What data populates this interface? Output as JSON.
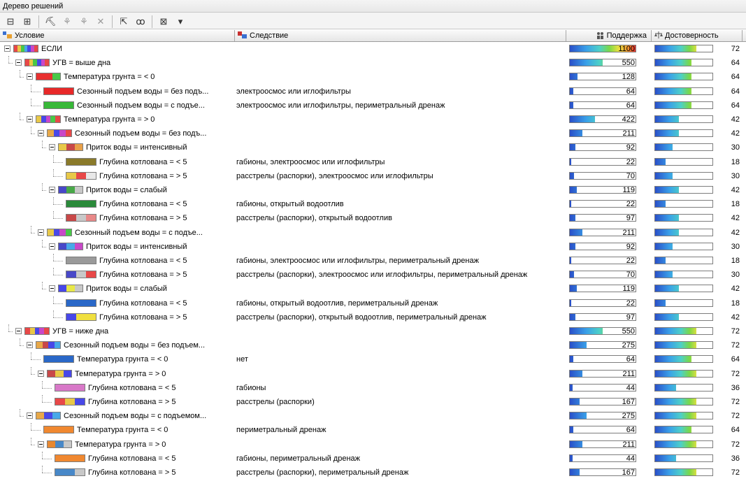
{
  "window": {
    "title": "Дерево решений"
  },
  "toolbar": {
    "buttons": [
      {
        "name": "collapse-all-icon",
        "glyph": "⊟"
      },
      {
        "name": "expand-all-icon",
        "glyph": "⊞"
      },
      {
        "name": "sep"
      },
      {
        "name": "tree-chart-icon",
        "glyph": "⛏"
      },
      {
        "name": "prune-icon",
        "glyph": "⚘",
        "dim": true
      },
      {
        "name": "split-icon",
        "glyph": "⚘",
        "dim": true
      },
      {
        "name": "delete-icon",
        "glyph": "✕",
        "dim": true
      },
      {
        "name": "sep"
      },
      {
        "name": "select-node-icon",
        "glyph": "⇱"
      },
      {
        "name": "view-icon",
        "glyph": "ꝏ"
      },
      {
        "name": "sep"
      },
      {
        "name": "excel-export-icon",
        "glyph": "⊠"
      },
      {
        "name": "dropdown-arrow-icon",
        "glyph": "▾"
      }
    ]
  },
  "columns": {
    "condition": "Условие",
    "consequence": "Следствие",
    "support": "Поддержка",
    "confidence": "Достоверность"
  },
  "colors": {
    "bar_blue": "#3a6fd0",
    "bar_cyan": "#4dc9e8",
    "bar_green": "#5bc85b",
    "bar_yellow": "#f0e040",
    "bar_orange": "#f09a30",
    "bar_red": "#e83030"
  },
  "rows": [
    {
      "level": 0,
      "label": "ЕСЛИ",
      "consequence": "",
      "support": 1100,
      "confidence": 72,
      "expander": true,
      "swatch": [
        "#e84848",
        "#e8c848",
        "#48c848",
        "#48a8e8",
        "#4848e8",
        "#c848c8",
        "#e84848"
      ]
    },
    {
      "level": 1,
      "label": "УГВ = выше дна",
      "consequence": "",
      "support": 550,
      "confidence": 64,
      "expander": true,
      "swatch": [
        "#e84848",
        "#e8c848",
        "#48c848",
        "#4848e8",
        "#c848c8",
        "#e84848"
      ]
    },
    {
      "level": 2,
      "label": "Температура грунта = < 0",
      "consequence": "",
      "support": 128,
      "confidence": 64,
      "expander": true,
      "swatch": [
        "#e83030",
        "#e83030",
        "#48c848"
      ]
    },
    {
      "level": 3,
      "label": "Сезонный подъем воды = без подъ...",
      "consequence": "электроосмос или иглофильтры",
      "support": 64,
      "confidence": 64,
      "expander": false,
      "swatch": [
        "#e82828"
      ]
    },
    {
      "level": 3,
      "label": "Сезонный подъем воды = с подъе...",
      "consequence": "электроосмос или иглофильтры, периметральный дренаж",
      "support": 64,
      "confidence": 64,
      "expander": false,
      "swatch": [
        "#38b838"
      ]
    },
    {
      "level": 2,
      "label": "Температура грунта = > 0",
      "consequence": "",
      "support": 422,
      "confidence": 42,
      "expander": true,
      "swatch": [
        "#e8c848",
        "#4848e8",
        "#c848c8",
        "#48c848",
        "#e84848"
      ]
    },
    {
      "level": 3,
      "label": "Сезонный подъем воды = без подъ...",
      "consequence": "",
      "support": 211,
      "confidence": 42,
      "expander": true,
      "swatch": [
        "#e8a848",
        "#4848e8",
        "#c848c8",
        "#e84848"
      ]
    },
    {
      "level": 4,
      "label": "Приток воды = интенсивный",
      "consequence": "",
      "support": 92,
      "confidence": 30,
      "expander": true,
      "swatch": [
        "#e8c848",
        "#c84848",
        "#e8a048"
      ]
    },
    {
      "level": 5,
      "label": "Глубина котлована = < 5",
      "consequence": "габионы, электроосмос или иглофильтры",
      "support": 22,
      "confidence": 18,
      "expander": false,
      "swatch": [
        "#8a7a2a"
      ]
    },
    {
      "level": 5,
      "label": "Глубина котлована = > 5",
      "consequence": "расстрелы (распорки), электроосмос или иглофильтры",
      "support": 70,
      "confidence": 30,
      "expander": false,
      "swatch": [
        "#e8c848",
        "#e84848",
        "#e8e8e8"
      ]
    },
    {
      "level": 4,
      "label": "Приток воды = слабый",
      "consequence": "",
      "support": 119,
      "confidence": 42,
      "expander": true,
      "swatch": [
        "#4848c8",
        "#48a848",
        "#c8c8c8"
      ]
    },
    {
      "level": 5,
      "label": "Глубина котлована = < 5",
      "consequence": "габионы, открытый водоотлив",
      "support": 22,
      "confidence": 18,
      "expander": false,
      "swatch": [
        "#2a8a3a"
      ]
    },
    {
      "level": 5,
      "label": "Глубина котлована = > 5",
      "consequence": "расстрелы (распорки), открытый водоотлив",
      "support": 97,
      "confidence": 42,
      "expander": false,
      "swatch": [
        "#c84848",
        "#c8c8c8",
        "#e88888"
      ]
    },
    {
      "level": 3,
      "label": "Сезонный подъем воды = с подъе...",
      "consequence": "",
      "support": 211,
      "confidence": 42,
      "expander": true,
      "swatch": [
        "#e8c848",
        "#4848e8",
        "#c848c8",
        "#48c848"
      ]
    },
    {
      "level": 4,
      "label": "Приток воды = интенсивный",
      "consequence": "",
      "support": 92,
      "confidence": 30,
      "expander": true,
      "swatch": [
        "#4848c8",
        "#48a8e8",
        "#c848c8"
      ]
    },
    {
      "level": 5,
      "label": "Глубина котлована = < 5",
      "consequence": "габионы, электроосмос или иглофильтры, периметральный дренаж",
      "support": 22,
      "confidence": 18,
      "expander": false,
      "swatch": [
        "#9a9a9a"
      ]
    },
    {
      "level": 5,
      "label": "Глубина котлована = > 5",
      "consequence": "расстрелы (распорки), электроосмос или иглофильтры, периметральный дренаж",
      "support": 70,
      "confidence": 30,
      "expander": false,
      "swatch": [
        "#4848c8",
        "#c8c8c8",
        "#e84848"
      ]
    },
    {
      "level": 4,
      "label": "Приток воды = слабый",
      "consequence": "",
      "support": 119,
      "confidence": 42,
      "expander": true,
      "swatch": [
        "#4848e8",
        "#e8e848",
        "#c8c8c8"
      ]
    },
    {
      "level": 5,
      "label": "Глубина котлована = < 5",
      "consequence": "габионы, открытый водоотлив, периметральный дренаж",
      "support": 22,
      "confidence": 18,
      "expander": false,
      "swatch": [
        "#2a68c8"
      ]
    },
    {
      "level": 5,
      "label": "Глубина котлована = > 5",
      "consequence": "расстрелы (распорки), открытый водоотлив, периметральный дренаж",
      "support": 97,
      "confidence": 42,
      "expander": false,
      "swatch": [
        "#4848e8",
        "#f0e040",
        "#f0e040"
      ]
    },
    {
      "level": 1,
      "label": "УГВ = ниже дна",
      "consequence": "",
      "support": 550,
      "confidence": 72,
      "expander": true,
      "swatch": [
        "#e84848",
        "#e8c848",
        "#4848e8",
        "#c848c8",
        "#e84848"
      ]
    },
    {
      "level": 2,
      "label": "Сезонный подъем воды = без подъем...",
      "consequence": "",
      "support": 275,
      "confidence": 72,
      "expander": true,
      "swatch": [
        "#e8a848",
        "#c84848",
        "#4848e8",
        "#48a8e8"
      ]
    },
    {
      "level": 3,
      "label": "Температура грунта = < 0",
      "consequence": "нет",
      "support": 64,
      "confidence": 64,
      "expander": false,
      "swatch": [
        "#2a68c8"
      ]
    },
    {
      "level": 3,
      "label": "Температура грунта = > 0",
      "consequence": "",
      "support": 211,
      "confidence": 72,
      "expander": true,
      "swatch": [
        "#c84848",
        "#e8c848",
        "#4848e8"
      ]
    },
    {
      "level": 4,
      "label": "Глубина котлована = < 5",
      "consequence": "габионы",
      "support": 44,
      "confidence": 36,
      "expander": false,
      "swatch": [
        "#d878c8"
      ]
    },
    {
      "level": 4,
      "label": "Глубина котлована = > 5",
      "consequence": "расстрелы (распорки)",
      "support": 167,
      "confidence": 72,
      "expander": false,
      "swatch": [
        "#e84848",
        "#e8c848",
        "#4848e8"
      ]
    },
    {
      "level": 2,
      "label": "Сезонный подъем воды = с подъемом...",
      "consequence": "",
      "support": 275,
      "confidence": 72,
      "expander": true,
      "swatch": [
        "#e8a848",
        "#4848e8",
        "#48a8e8"
      ]
    },
    {
      "level": 3,
      "label": "Температура грунта = < 0",
      "consequence": "периметральный дренаж",
      "support": 64,
      "confidence": 64,
      "expander": false,
      "swatch": [
        "#f08830"
      ]
    },
    {
      "level": 3,
      "label": "Температура грунта = > 0",
      "consequence": "",
      "support": 211,
      "confidence": 72,
      "expander": true,
      "swatch": [
        "#e88830",
        "#4888c8",
        "#c8c8c8"
      ]
    },
    {
      "level": 4,
      "label": "Глубина котлована = < 5",
      "consequence": "габионы, периметральный дренаж",
      "support": 44,
      "confidence": 36,
      "expander": false,
      "swatch": [
        "#f08830"
      ]
    },
    {
      "level": 4,
      "label": "Глубина котлована = > 5",
      "consequence": "расстрелы (распорки), периметральный дренаж",
      "support": 167,
      "confidence": 72,
      "expander": false,
      "swatch": [
        "#4888c8",
        "#4888c8",
        "#c8c8c8"
      ]
    }
  ]
}
